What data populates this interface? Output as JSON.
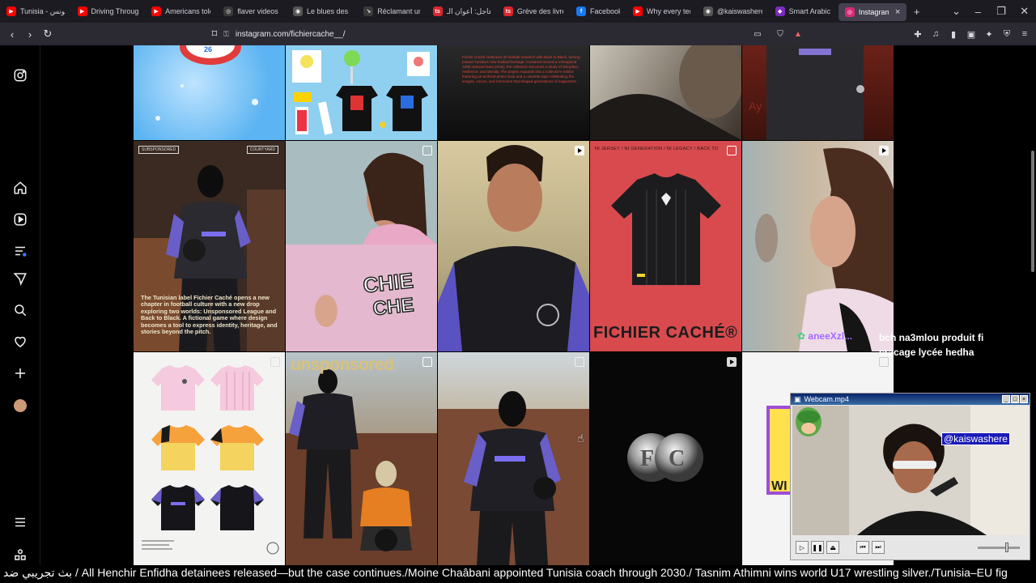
{
  "browser": {
    "tabs": [
      {
        "title": "Tunisia - تونس",
        "color": "#ff0000",
        "glyph": "▶"
      },
      {
        "title": "Driving Through",
        "color": "#ff0000",
        "glyph": "▶"
      },
      {
        "title": "Americans told",
        "color": "#ff0000",
        "glyph": "▶"
      },
      {
        "title": "flaver videos -",
        "color": "#3a3a3a",
        "glyph": "◎"
      },
      {
        "title": "Le blues des li",
        "color": "#555",
        "glyph": "◉"
      },
      {
        "title": "Réclamant un",
        "color": "#3a3a3a",
        "glyph": "↘"
      },
      {
        "title": "عاجل: أعوان الـ",
        "color": "#d9262c",
        "glyph": "ts"
      },
      {
        "title": "Grève des livre",
        "color": "#d9262c",
        "glyph": "ts"
      },
      {
        "title": "Facebook",
        "color": "#1877f2",
        "glyph": "f"
      },
      {
        "title": "Why every tec",
        "color": "#ff0000",
        "glyph": "▶"
      },
      {
        "title": "@kaiswashere",
        "color": "#555",
        "glyph": "◉"
      },
      {
        "title": "Smart Arabic I",
        "color": "#7b2cbf",
        "glyph": "◆"
      },
      {
        "title": "Instagram",
        "color": "#d62976",
        "glyph": "◎",
        "active": true
      }
    ],
    "url": "instagram.com/fichiercache__/"
  },
  "grid": {
    "row1": [
      {
        "kind": "blue-sky"
      },
      {
        "kind": "products"
      },
      {
        "kind": "dark-text",
        "caption": "Fichier Caché continues its football research with Back to Black, turning toward Tunisia's new football heritage. Centered around a reimagined 1996 national team jersey, the collection becomes a study of discipline, resilience, and identity. The project expands into a collector's edition featuring an archival photo book and a cassette tape celebrating the images, voices, and memories that shaped generations of supporters."
      },
      {
        "kind": "portrait"
      },
      {
        "kind": "red-jersey"
      }
    ],
    "row2": [
      {
        "kind": "masked",
        "tagline": "The Tunisian label Fichier Caché opens a new chapter in football culture with a new drop exploring two worlds: Unsponsored League and Back to Black. A fictional game where design becomes a tool to express identity, heritage, and stories beyond the pitch.",
        "tags": [
          "SUBSPONSORED",
          "COURTYARD"
        ]
      },
      {
        "kind": "woman-collage"
      },
      {
        "kind": "man-down"
      },
      {
        "kind": "jersey-red",
        "topline": "NI JERSEY / NI GENERATION / NI LEGACY / BACK TO",
        "brand": "FICHIER CACHÉ®"
      },
      {
        "kind": "woman-profile",
        "handle": "aneeXzl..."
      }
    ],
    "row3": [
      {
        "kind": "jersey-grid"
      },
      {
        "kind": "unsponsored",
        "headline": "unsponsored"
      },
      {
        "kind": "masked-ball"
      },
      {
        "kind": "coin"
      },
      {
        "kind": "white"
      }
    ]
  },
  "overlay_text": [
    "bch na3mlou produit fi",
    "cracage lycée hedha"
  ],
  "webcam": {
    "title": "Webcam.mp4",
    "handle": "@kaiswashere"
  },
  "ticker": "بث تجريبي ضد / All Henchir Enfidha detainees released—but the case continues./Moine Chaâbani appointed Tunisia coach through 2030./ Tasnim Athimni wins world U17 wrestling silver./Tunisia–EU fig"
}
